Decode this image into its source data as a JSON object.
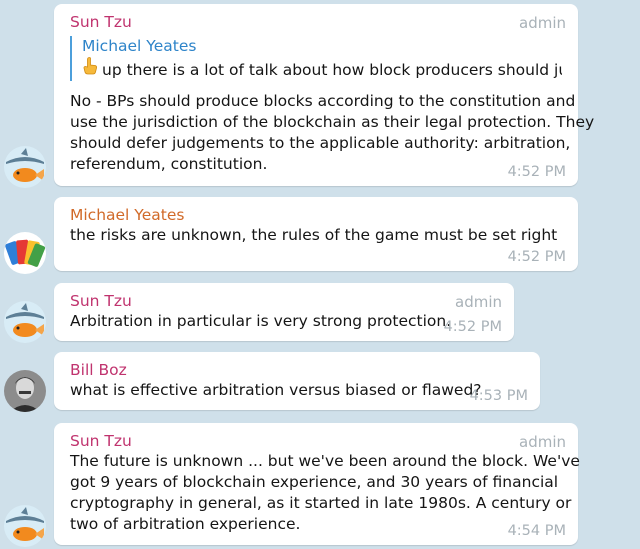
{
  "colors": {
    "background": "#cfe0ea",
    "sun_tzu_name": "#c0336e",
    "michael_name": "#d16a29",
    "bill_name": "#c0336e",
    "reply_name": "#2e84c9",
    "meta": "#a9b2b8"
  },
  "messages": [
    {
      "sender": "Sun Tzu",
      "role": "admin",
      "reply": {
        "name": "Michael Yeates",
        "icon": "pointing-up-hand-icon",
        "text": "up there is a lot of talk about how block producers should jus..."
      },
      "lines": [
        "No - BPs should produce blocks according to the constitution and",
        "use the jurisdiction of the blockchain as their legal protection.  They",
        "should defer judgements to the applicable authority:  arbitration,",
        "referendum, constitution."
      ],
      "time": "4:52 PM",
      "avatar": "goldfish-shark-avatar"
    },
    {
      "sender": "Michael Yeates",
      "lines": [
        "the risks are unknown, the rules of the game must be set right"
      ],
      "time": "4:52 PM",
      "avatar": "color-tags-avatar"
    },
    {
      "sender": "Sun Tzu",
      "role": "admin",
      "lines": [
        "Arbitration in particular is very strong protection."
      ],
      "time": "4:52 PM",
      "avatar": "goldfish-shark-avatar"
    },
    {
      "sender": "Bill Boz",
      "lines": [
        "what is effective arbitration versus biased or flawed?"
      ],
      "time": "4:53 PM",
      "avatar": "man-portrait-avatar"
    },
    {
      "sender": "Sun Tzu",
      "role": "admin",
      "lines": [
        "The future is unknown ... but we've been around the block.  We've",
        "got 9 years of blockchain experience, and 30 years of financial",
        "cryptography in general, as it started in late 1980s.  A century or",
        "two of arbitration experience."
      ],
      "time": "4:54 PM",
      "avatar": "goldfish-shark-avatar"
    }
  ]
}
